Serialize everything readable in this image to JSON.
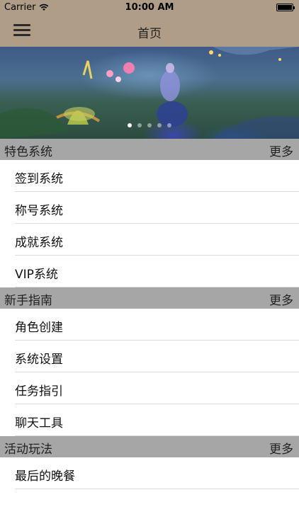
{
  "status_bar": {
    "carrier": "Carrier",
    "time": "10:00 AM"
  },
  "navbar": {
    "title": "首页",
    "menu_icon": "hamburger-menu-icon"
  },
  "banner": {
    "page_count": 5,
    "active_page": 1
  },
  "sections": [
    {
      "title": "特色系统",
      "more_label": "更多",
      "items": [
        "签到系统",
        "称号系统",
        "成就系统",
        "VIP系统"
      ]
    },
    {
      "title": "新手指南",
      "more_label": "更多",
      "items": [
        "角色创建",
        "系统设置",
        "任务指引",
        "聊天工具"
      ]
    },
    {
      "title": "活动玩法",
      "more_label": "更多",
      "items": [
        "最后的晚餐"
      ]
    }
  ],
  "colors": {
    "navbar_bg": "#b09d87",
    "section_header_bg": "#a6a6a6",
    "separator": "#dcdcdc"
  }
}
